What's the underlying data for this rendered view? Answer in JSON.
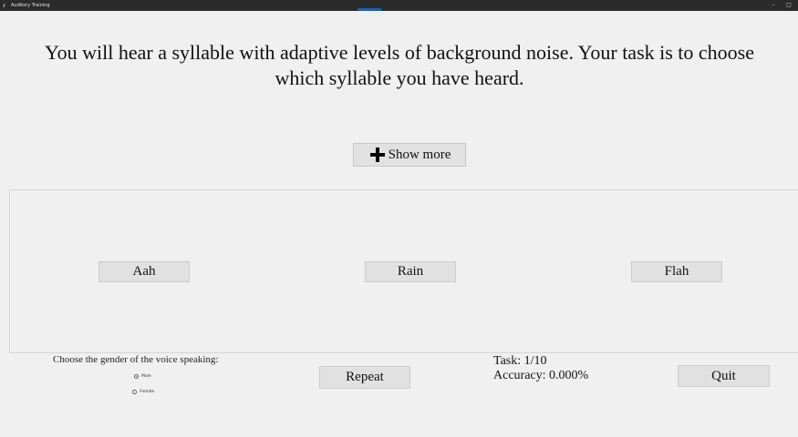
{
  "window": {
    "title": "Auditory Training",
    "controls": [
      "–",
      "□"
    ]
  },
  "instructions": {
    "text": "You will hear a syllable with adaptive levels of background noise. Your task is to choose\nwhich syllable you have heard."
  },
  "show_more": {
    "icon": "plus-icon",
    "label": "Show more"
  },
  "syllables": [
    {
      "label": "Aah"
    },
    {
      "label": "Rain"
    },
    {
      "label": "Flah"
    }
  ],
  "gender": {
    "prompt": "Choose the gender of the voice speaking:",
    "options": [
      {
        "label": "Male",
        "selected": true
      },
      {
        "label": "Female",
        "selected": false
      }
    ]
  },
  "repeat_label": "Repeat",
  "status": {
    "task": "Task: 1/10",
    "accuracy": "Accuracy: 0.000%"
  },
  "quit_label": "Quit"
}
